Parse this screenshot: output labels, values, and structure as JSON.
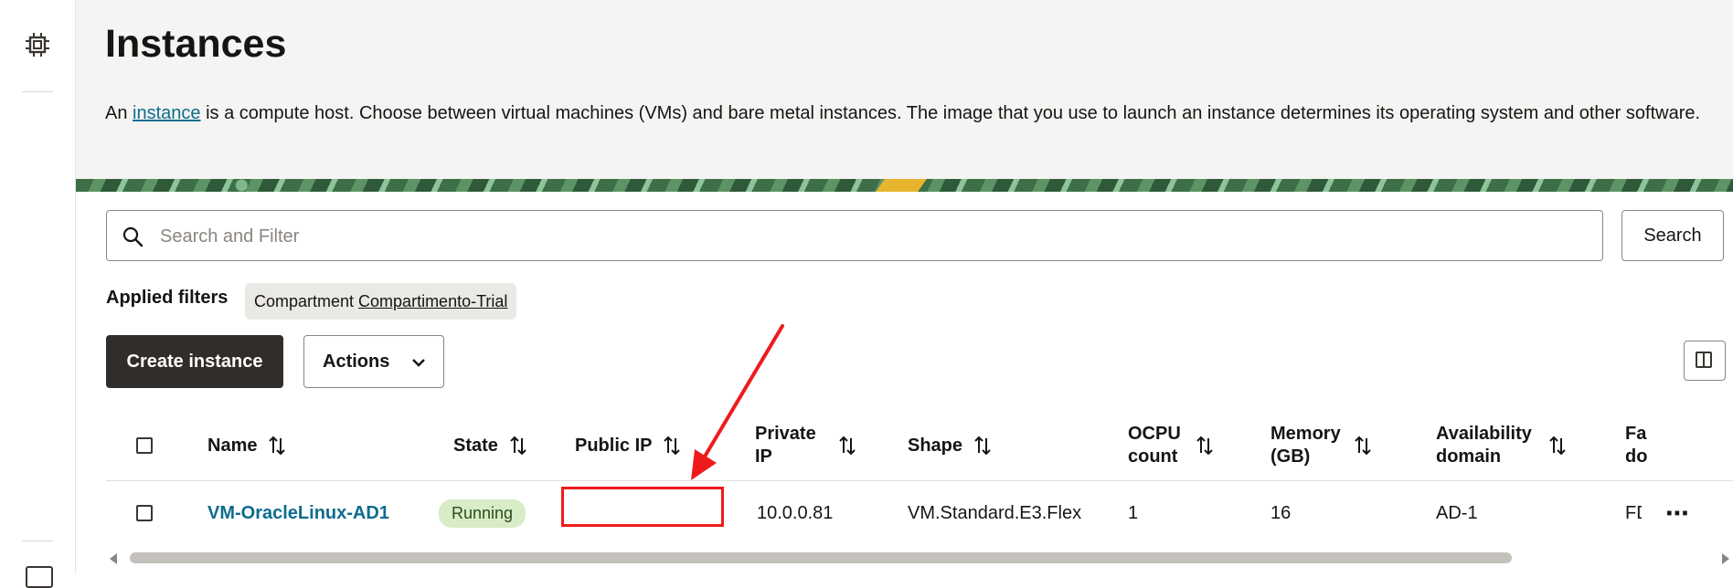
{
  "page": {
    "title": "Instances",
    "description_prefix": "An ",
    "description_link": "instance",
    "description_suffix": " is a compute host. Choose between virtual machines (VMs) and bare metal instances. The image that you use to launch an instance determines its operating system and other software."
  },
  "search": {
    "placeholder": "Search and Filter",
    "button_label": "Search"
  },
  "filters": {
    "label": "Applied filters",
    "chips": [
      {
        "key": "Compartment",
        "value": "Compartimento-Trial"
      }
    ]
  },
  "toolbar": {
    "create_label": "Create instance",
    "actions_label": "Actions"
  },
  "table": {
    "columns": [
      "Name",
      "State",
      "Public IP",
      "Private IP",
      "Shape",
      "OCPU count",
      "Memory (GB)",
      "Availability domain",
      "Fault domain"
    ],
    "column_display": {
      "name": "Name",
      "state": "State",
      "public_ip": "Public IP",
      "private_ip_1": "Private",
      "private_ip_2": "IP",
      "shape": "Shape",
      "ocpu_1": "OCPU",
      "ocpu_2": "count",
      "memory_1": "Memory",
      "memory_2": "(GB)",
      "ad_1": "Availability",
      "ad_2": "domain",
      "fd_1": "Fa",
      "fd_2": "do"
    },
    "rows": [
      {
        "name": "VM-OracleLinux-AD1",
        "state": "Running",
        "public_ip": "",
        "private_ip": "10.0.0.81",
        "shape": "VM.Standard.E3.Flex",
        "ocpu": "1",
        "memory": "16",
        "availability_domain": "AD-1",
        "fault_domain": "FD",
        "menu": "⋯"
      }
    ]
  },
  "colors": {
    "link": "#0d6c8e",
    "primary_button": "#312d2a",
    "running_badge": "#d7ecc7",
    "annotation": "#ee1b1b"
  },
  "icons": [
    "chip-icon",
    "search-icon",
    "chevron-down-icon",
    "columns-icon",
    "sort-icon",
    "more-icon"
  ]
}
